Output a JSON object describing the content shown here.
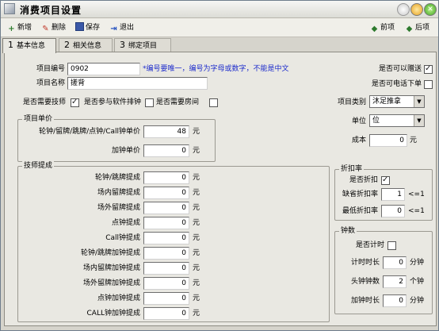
{
  "window": {
    "title": "消费项目设置"
  },
  "toolbar": {
    "add": "新增",
    "delete": "删除",
    "save": "保存",
    "exit": "退出",
    "prev": "前项",
    "next": "后项"
  },
  "tabs": [
    {
      "num": "1",
      "label": "基本信息"
    },
    {
      "num": "2",
      "label": "相关信息"
    },
    {
      "num": "3",
      "label": "绑定项目"
    }
  ],
  "form": {
    "item_code_label": "项目编号",
    "item_code": "0902",
    "hint": "*编号要唯一，编号为字母或数字，不能是中文",
    "item_name_label": "项目名称",
    "item_name": "搓背",
    "need_tech_label": "是否需要技师",
    "need_tech": true,
    "soft_rank_label": "是否参与软件排钟",
    "soft_rank": false,
    "need_room_label": "是否需要房间",
    "need_room": false,
    "giftable_label": "是否可以赠送",
    "giftable": true,
    "phone_order_label": "是否可电话下单",
    "phone_order": false,
    "category_label": "项目类别",
    "category": "沐足推拿",
    "unit_label": "单位",
    "unit": "位",
    "cost_label": "成本",
    "cost": "0",
    "cost_unit": "元"
  },
  "price": {
    "title": "项目单价",
    "items": [
      {
        "label": "轮钟/留牌/跳牌/点钟/Call钟单价",
        "value": "48",
        "unit": "元"
      },
      {
        "label": "加钟单价",
        "value": "0",
        "unit": "元"
      }
    ]
  },
  "commission": {
    "title": "技师提成",
    "items": [
      {
        "label": "轮钟/跳牌提成",
        "value": "0",
        "unit": "元"
      },
      {
        "label": "场内留牌提成",
        "value": "0",
        "unit": "元"
      },
      {
        "label": "场外留牌提成",
        "value": "0",
        "unit": "元"
      },
      {
        "label": "点钟提成",
        "value": "0",
        "unit": "元"
      },
      {
        "label": "Call钟提成",
        "value": "0",
        "unit": "元"
      },
      {
        "label": "轮钟/跳牌加钟提成",
        "value": "0",
        "unit": "元"
      },
      {
        "label": "场内留牌加钟提成",
        "value": "0",
        "unit": "元"
      },
      {
        "label": "场外留牌加钟提成",
        "value": "0",
        "unit": "元"
      },
      {
        "label": "点钟加钟提成",
        "value": "0",
        "unit": "元"
      },
      {
        "label": "CALL钟加钟提成",
        "value": "0",
        "unit": "元"
      }
    ]
  },
  "discount": {
    "title": "折扣率",
    "enabled_label": "是否折扣",
    "enabled": true,
    "default_label": "缺省折扣率",
    "default": "1",
    "default_hint": "<=1",
    "min_label": "最低折扣率",
    "min": "0",
    "min_hint": "<=1"
  },
  "timing": {
    "title": "钟数",
    "timed_label": "是否计时",
    "timed": false,
    "duration_label": "计时时长",
    "duration": "0",
    "duration_unit": "分钟",
    "first_label": "头钟钟数",
    "first": "2",
    "first_unit": "个钟",
    "extra_label": "加钟时长",
    "extra": "0",
    "extra_unit": "分钟"
  }
}
